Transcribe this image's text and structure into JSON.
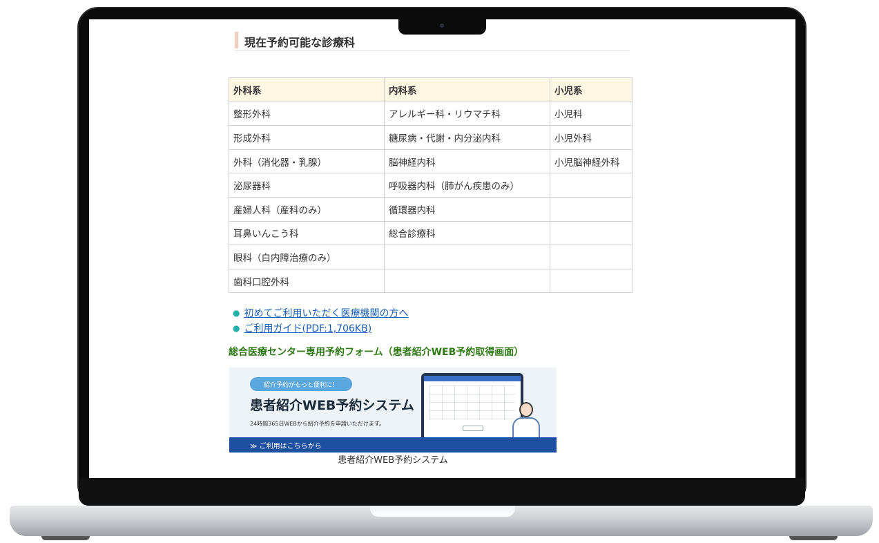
{
  "section_heading": "現在予約可能な診療科",
  "table": {
    "headers": [
      "外科系",
      "内科系",
      "小児系"
    ],
    "rows": [
      [
        "整形外科",
        "アレルギー科・リウマチ科",
        "小児科"
      ],
      [
        "形成外科",
        "糖尿病・代謝・内分泌内科",
        "小児外科"
      ],
      [
        "外科（消化器・乳腺）",
        "脳神経内科",
        "小児脳神経外科"
      ],
      [
        "泌尿器科",
        "呼吸器内科（肺がん疾患のみ）",
        ""
      ],
      [
        "産婦人科（産科のみ）",
        "循環器内科",
        ""
      ],
      [
        "耳鼻いんこう科",
        "総合診療科",
        ""
      ],
      [
        "眼科（白内障治療のみ）",
        "",
        ""
      ],
      [
        "歯科口腔外科",
        "",
        ""
      ]
    ]
  },
  "links": [
    {
      "label": "初めてご利用いただく医療機関の方へ"
    },
    {
      "label": "ご利用ガイド(PDF:1,706KB)"
    }
  ],
  "form_title": "総合医療センター専用予約フォーム（患者紹介WEB予約取得画面）",
  "banner": {
    "pill": "紹介予約がもっと便利に！",
    "title": "患者紹介WEB予約システム",
    "subtitle": "24時間365日WEBから紹介予約を申請いただけます。",
    "cta": "≫ ご利用はこちらから"
  },
  "caption": "患者紹介WEB予約システム",
  "colors": {
    "table_header_bg": "#fdf6e3",
    "link": "#1a5fb4",
    "form_title": "#2f7a16",
    "banner_cta_bg": "#1f4fa0"
  }
}
